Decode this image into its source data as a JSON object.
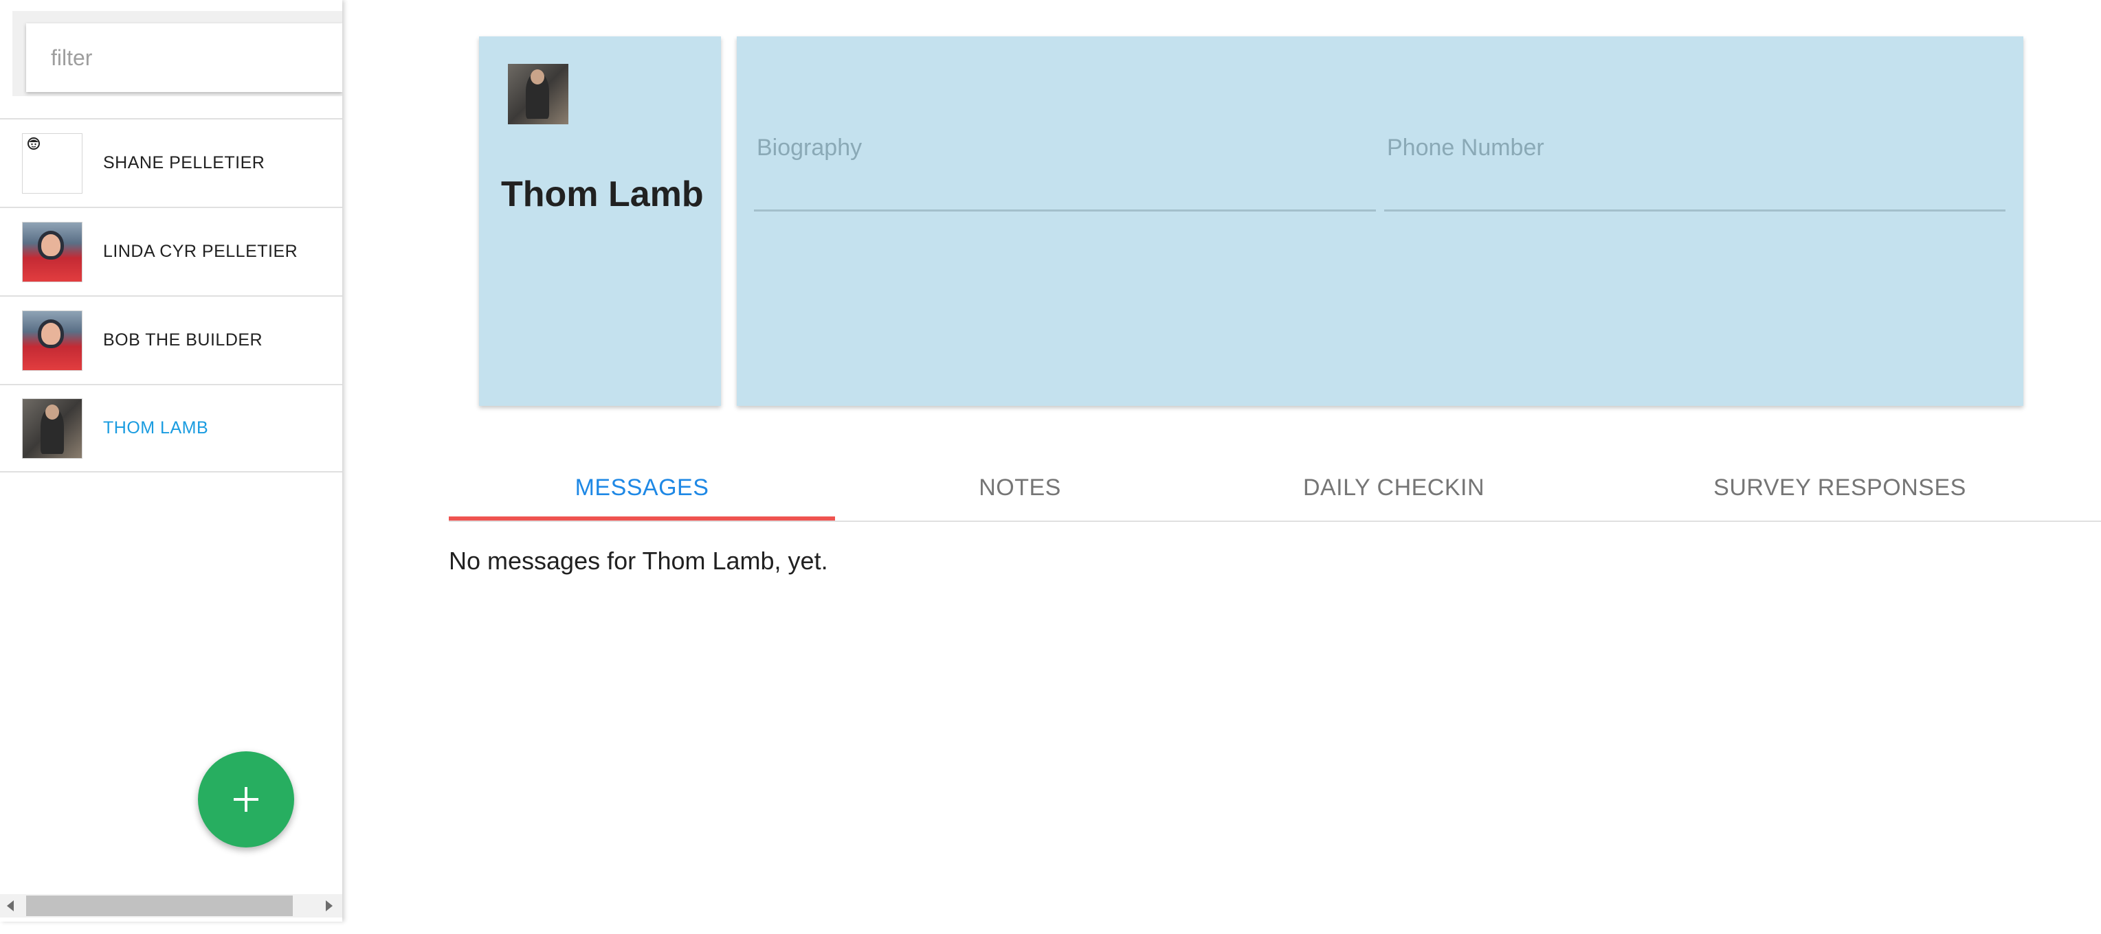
{
  "sidebar": {
    "filter": {
      "placeholder": "filter",
      "value": ""
    },
    "patients": [
      {
        "name": "SHANE PELLETIER",
        "avatar": "default-face-icon",
        "selected": false
      },
      {
        "name": "LINDA CYR PELLETIER",
        "avatar": "photo",
        "selected": false
      },
      {
        "name": "BOB THE BUILDER",
        "avatar": "photo",
        "selected": false
      },
      {
        "name": "THOM LAMB",
        "avatar": "photo",
        "selected": true
      }
    ],
    "add_button": {
      "icon": "plus-icon"
    }
  },
  "profile": {
    "name": "Thom Lamb",
    "biography": {
      "label": "Biography",
      "value": ""
    },
    "phone": {
      "label": "Phone Number",
      "value": ""
    }
  },
  "tabs": [
    {
      "label": "MESSAGES",
      "active": true
    },
    {
      "label": "NOTES",
      "active": false
    },
    {
      "label": "DAILY CHECKIN",
      "active": false
    },
    {
      "label": "SURVEY RESPONSES",
      "active": false
    }
  ],
  "messages": {
    "empty_text": "No messages for Thom Lamb, yet."
  },
  "colors": {
    "card_background": "#c4e1ee",
    "selected_text": "#1a9ce0",
    "active_tab_text": "#1e88e5",
    "tab_indicator": "#ef5350",
    "fab": "#27ae60"
  }
}
